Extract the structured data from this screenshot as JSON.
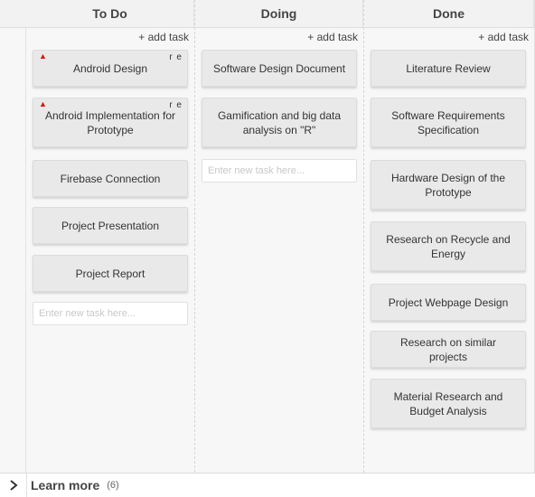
{
  "columns": {
    "todo": {
      "title": "To Do",
      "add_label": "+ add task",
      "input_placeholder": "Enter new task here...",
      "cards": [
        {
          "text": "Android Design",
          "priority_icon": "red-arrow-up",
          "corner": "r e"
        },
        {
          "text": "Android Implementation for Prototype",
          "priority_icon": "red-arrow-up",
          "corner": "r e"
        },
        {
          "text": "Firebase Connection"
        },
        {
          "text": "Project Presentation"
        },
        {
          "text": "Project Report"
        }
      ]
    },
    "doing": {
      "title": "Doing",
      "add_label": "+ add task",
      "input_placeholder": "Enter new task here...",
      "cards": [
        {
          "text": "Software Design Document"
        },
        {
          "text": "Gamification and big data analysis on \"R\""
        }
      ]
    },
    "done": {
      "title": "Done",
      "add_label": "+ add task",
      "cards": [
        {
          "text": "Literature Review"
        },
        {
          "text": "Software Requirements Specification"
        },
        {
          "text": "Hardware Design of the Prototype"
        },
        {
          "text": "Research on Recycle and Energy"
        },
        {
          "text": "Project Webpage Design"
        },
        {
          "text": "Research on similar projects"
        },
        {
          "text": "Material Research and Budget Analysis"
        }
      ]
    }
  },
  "footer": {
    "title": "Learn more",
    "count": "(6)",
    "expand_icon": "chevron-right-icon"
  },
  "colors": {
    "priority": "#e01010",
    "card_bg": "#e9e9e9",
    "column_bg": "#f7f7f7"
  }
}
